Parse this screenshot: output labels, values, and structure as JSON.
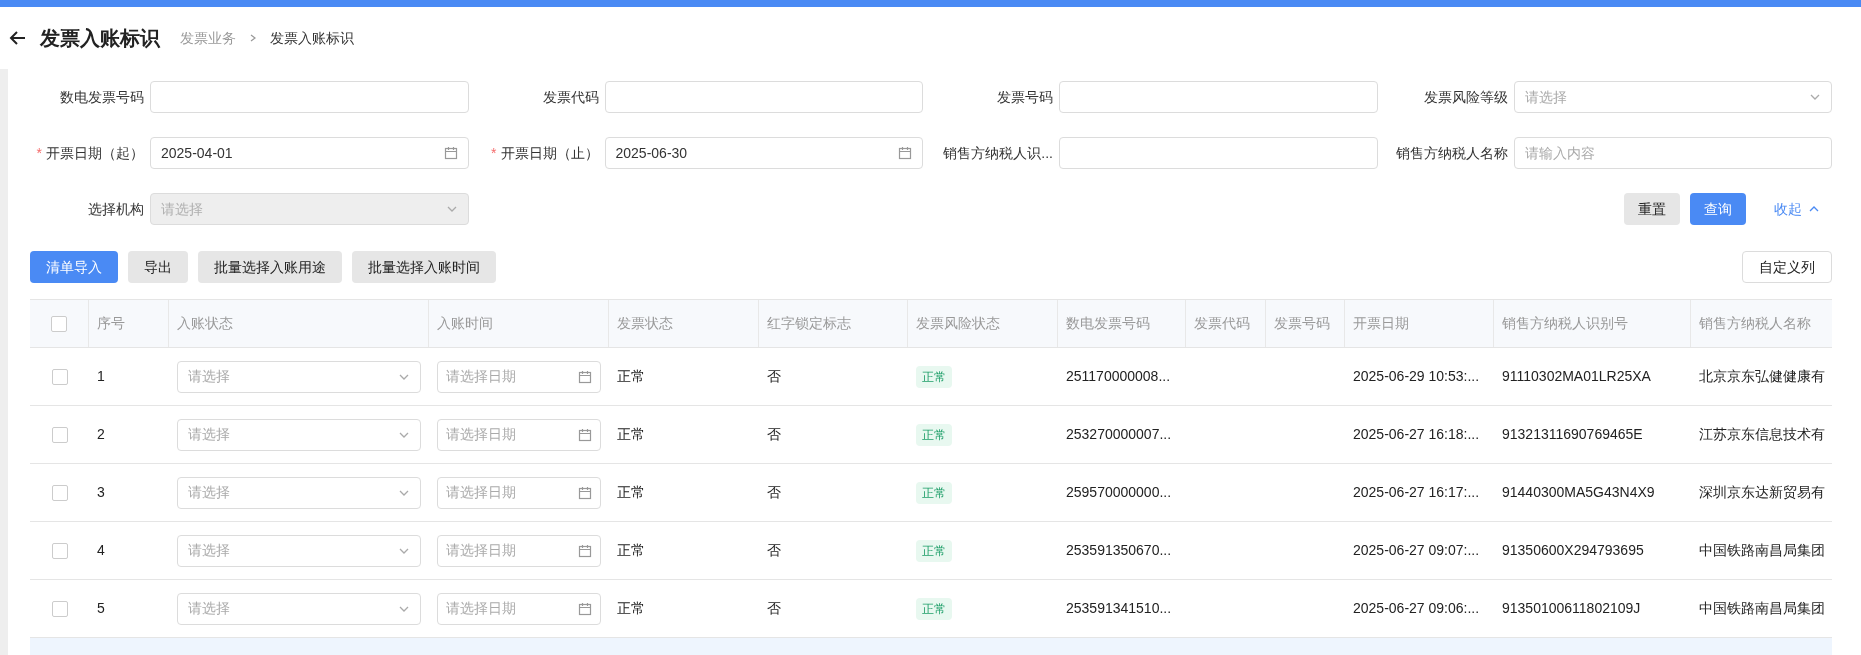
{
  "header": {
    "title": "发票入账标识",
    "breadcrumb": [
      "发票业务",
      "发票入账标识"
    ]
  },
  "filters": [
    {
      "kind": "text",
      "label": "数电发票号码"
    },
    {
      "kind": "text",
      "label": "发票代码"
    },
    {
      "kind": "text",
      "label": "发票号码"
    },
    {
      "kind": "select",
      "label": "发票风险等级",
      "placeholder": "请选择",
      "disabled": false
    },
    {
      "kind": "date",
      "label": "开票日期（起）",
      "required_mark": "*",
      "value": "2025-04-01"
    },
    {
      "kind": "date",
      "label": "开票日期（止）",
      "required_mark": "*",
      "value": "2025-06-30"
    },
    {
      "kind": "text",
      "label": "销售方纳税人识..."
    },
    {
      "kind": "text",
      "label": "销售方纳税人名称",
      "placeholder": "请输入内容"
    },
    {
      "kind": "select",
      "label": "选择机构",
      "placeholder": "请选择",
      "disabled": true
    }
  ],
  "filter_actions": {
    "reset": "重置",
    "search": "查询",
    "collapse": "收起"
  },
  "toolbar": {
    "buttons": [
      {
        "label": "清单导入",
        "primary": true
      },
      {
        "label": "导出",
        "primary": false
      },
      {
        "label": "批量选择入账用途",
        "primary": false
      },
      {
        "label": "批量选择入账时间",
        "primary": false
      }
    ],
    "custom_columns": "自定义列"
  },
  "table": {
    "columns": [
      "序号",
      "入账状态",
      "入账时间",
      "发票状态",
      "红字锁定标志",
      "发票风险状态",
      "数电发票号码",
      "发票代码",
      "发票号码",
      "开票日期",
      "销售方纳税人识别号",
      "销售方纳税人名称"
    ],
    "all_checked": false,
    "rows": [
      {
        "checked": false,
        "index": "1",
        "status_placeholder": "请选择",
        "time_placeholder": "请选择日期",
        "invoice_status": "正常",
        "red_lock": "否",
        "risk": "正常",
        "number": "251170000008...",
        "issue_date": "2025-06-29 10:53:...",
        "seller_id": "91110302MA01LR25XA",
        "seller_name": "北京京东弘健健康有"
      },
      {
        "checked": false,
        "index": "2",
        "status_placeholder": "请选择",
        "time_placeholder": "请选择日期",
        "invoice_status": "正常",
        "red_lock": "否",
        "risk": "正常",
        "number": "253270000007...",
        "issue_date": "2025-06-27 16:18:...",
        "seller_id": "91321311690769465E",
        "seller_name": "江苏京东信息技术有"
      },
      {
        "checked": false,
        "index": "3",
        "status_placeholder": "请选择",
        "time_placeholder": "请选择日期",
        "invoice_status": "正常",
        "red_lock": "否",
        "risk": "正常",
        "number": "259570000000...",
        "issue_date": "2025-06-27 16:17:...",
        "seller_id": "91440300MA5G43N4X9",
        "seller_name": "深圳京东达新贸易有"
      },
      {
        "checked": false,
        "index": "4",
        "status_placeholder": "请选择",
        "time_placeholder": "请选择日期",
        "invoice_status": "正常",
        "red_lock": "否",
        "risk": "正常",
        "number": "253591350670...",
        "issue_date": "2025-06-27 09:07:...",
        "seller_id": "91350600X294793695",
        "seller_name": "中国铁路南昌局集团"
      },
      {
        "checked": false,
        "index": "5",
        "status_placeholder": "请选择",
        "time_placeholder": "请选择日期",
        "invoice_status": "正常",
        "red_lock": "否",
        "risk": "正常",
        "number": "253591341510...",
        "issue_date": "2025-06-27 09:06:...",
        "seller_id": "91350100611802109J",
        "seller_name": "中国铁路南昌局集团"
      }
    ]
  }
}
